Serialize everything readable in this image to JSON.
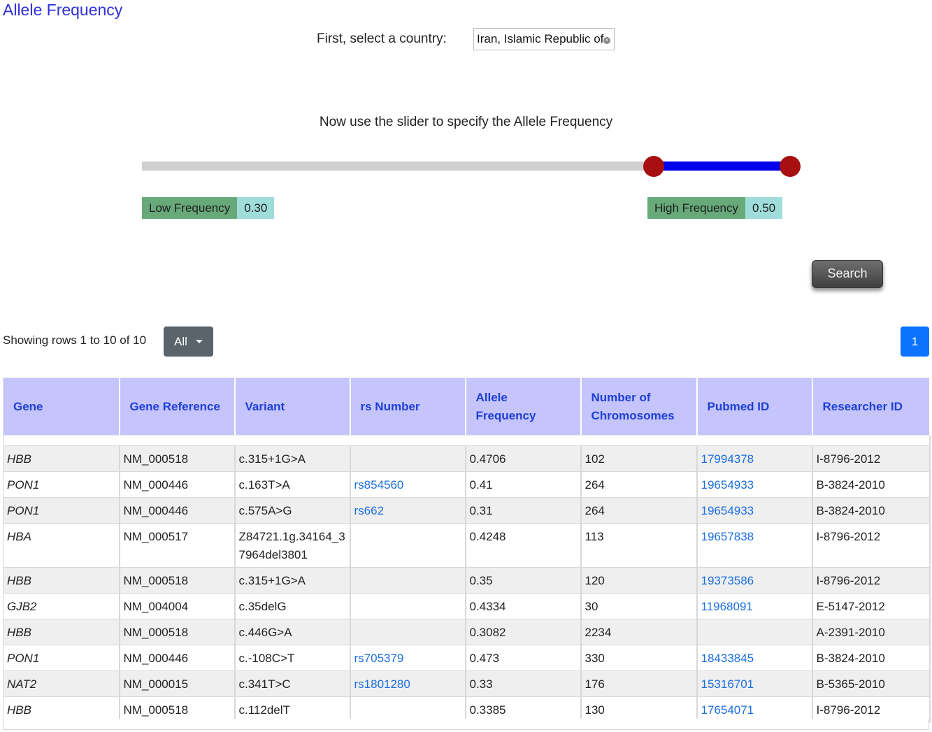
{
  "page": {
    "title": "Allele Frequency"
  },
  "country": {
    "label": "First, select a country:",
    "selected": "Iran, Islamic Republic of"
  },
  "slider": {
    "instruction": "Now use the slider to specify the Allele Frequency",
    "low_value": 0.3,
    "high_value": 0.5,
    "min": -0.45,
    "max": 0.5,
    "low_label": "Low Frequency",
    "low_display": "0.30",
    "high_label": "High Frequency",
    "high_display": "0.50",
    "colors": {
      "track": "#cfcfcf",
      "range": "#0000ee",
      "handle": "#a80f10"
    }
  },
  "search": {
    "label": "Search"
  },
  "pagination": {
    "showing_text": "Showing rows 1 to 10 of 10",
    "page_size_label": "All",
    "current_page": "1"
  },
  "table": {
    "columns": [
      "Gene",
      "Gene Reference",
      "Variant",
      "rs Number",
      "Allele Frequency",
      "Number of Chromosomes",
      "Pubmed ID",
      "Researcher ID"
    ],
    "rows": [
      [
        "HBB",
        "NM_000518",
        "c.315+1G>A",
        "",
        "0.4706",
        "102",
        "17994378",
        "I-8796-2012"
      ],
      [
        "PON1",
        "NM_000446",
        "c.163T>A",
        "rs854560",
        "0.41",
        "264",
        "19654933",
        "B-3824-2010"
      ],
      [
        "PON1",
        "NM_000446",
        "c.575A>G",
        "rs662",
        "0.31",
        "264",
        "19654933",
        "B-3824-2010"
      ],
      [
        "HBA",
        "NM_000517",
        "Z84721.1g.34164_37964del3801",
        "",
        "0.4248",
        "113",
        "19657838",
        "I-8796-2012"
      ],
      [
        "HBB",
        "NM_000518",
        "c.315+1G>A",
        "",
        "0.35",
        "120",
        "19373586",
        "I-8796-2012"
      ],
      [
        "GJB2",
        "NM_004004",
        "c.35delG",
        "",
        "0.4334",
        "30",
        "11968091",
        "E-5147-2012"
      ],
      [
        "HBB",
        "NM_000518",
        "c.446G>A",
        "",
        "0.3082",
        "2234",
        "",
        "A-2391-2010"
      ],
      [
        "PON1",
        "NM_000446",
        "c.-108C>T",
        "rs705379",
        "0.473",
        "330",
        "18433845",
        "B-3824-2010"
      ],
      [
        "NAT2",
        "NM_000015",
        "c.341T>C",
        "rs1801280",
        "0.33",
        "176",
        "15316701",
        "B-5365-2010"
      ],
      [
        "HBB",
        "NM_000518",
        "c.112delT",
        "",
        "0.3385",
        "130",
        "17654071",
        "I-8796-2012"
      ]
    ]
  }
}
